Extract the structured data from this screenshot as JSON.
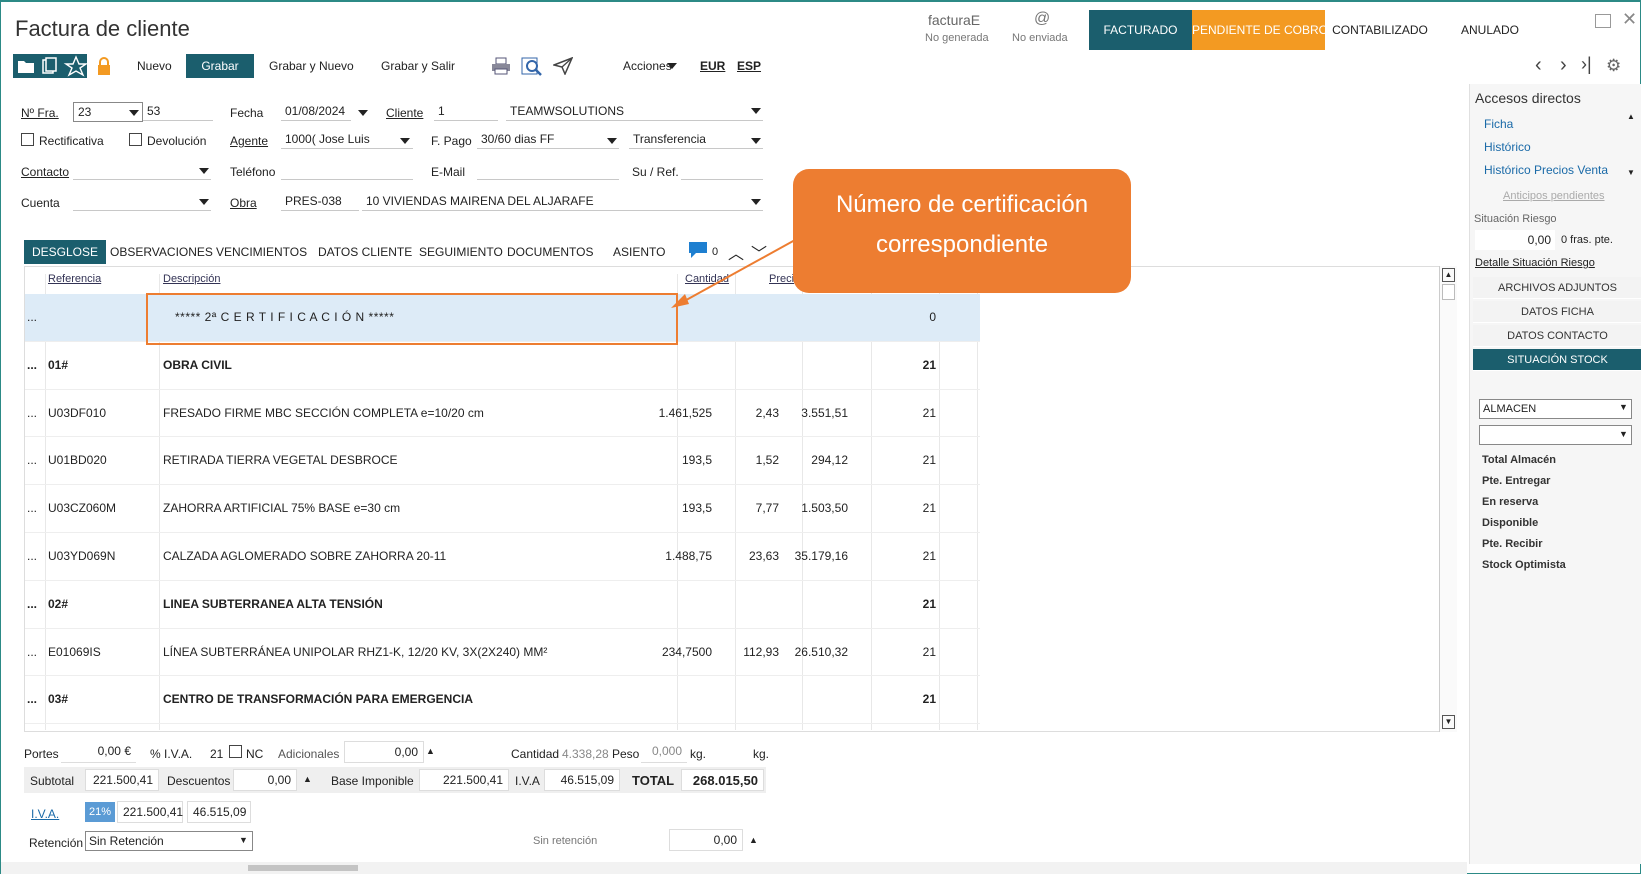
{
  "window": {
    "title": "Factura de cliente"
  },
  "status": {
    "factura_e": "facturaE",
    "no_generada": "No generada",
    "at": "@",
    "no_enviada": "No enviada",
    "facturado": "FACTURADO",
    "pendiente": "PENDIENTE DE COBRO",
    "contabilizado": "CONTABILIZADO",
    "anulado": "ANULADO"
  },
  "toolbar": {
    "nuevo": "Nuevo",
    "grabar": "Grabar",
    "grabar_nuevo": "Grabar y Nuevo",
    "grabar_salir": "Grabar y Salir",
    "acciones": "Acciones",
    "eur": "EUR",
    "esp": "ESP"
  },
  "form": {
    "nfra_label": "Nº Fra.",
    "nfra_serie": "23",
    "nfra_num": "53",
    "fecha_label": "Fecha",
    "fecha": "01/08/2024",
    "cliente_label": "Cliente",
    "cliente_code": "1",
    "cliente_name": "TEAMWSOLUTIONS",
    "rectificativa": "Rectificativa",
    "devolucion": "Devolución",
    "agente_label": "Agente",
    "agente_code": "1000(",
    "agente_name": "Jose Luis",
    "fpago_label": "F. Pago",
    "fpago": "30/60 dias FF",
    "transferencia": "Transferencia",
    "contacto_label": "Contacto",
    "telefono_label": "Teléfono",
    "email_label": "E-Mail",
    "suref_label": "Su / Ref.",
    "cuenta_label": "Cuenta",
    "obra_label": "Obra",
    "obra_code": "PRES-038",
    "obra_name": "10 VIVIENDAS MAIRENA DEL ALJARAFE"
  },
  "tabs": [
    "DESGLOSE",
    "OBSERVACIONES",
    "VENCIMIENTOS",
    "DATOS CLIENTE",
    "SEGUIMIENTO",
    "DOCUMENTOS",
    "ASIENTO"
  ],
  "comment_count": "0",
  "grid": {
    "headers": {
      "referencia": "Referencia",
      "descripcion": "Descripción",
      "cantidad": "Cantidad",
      "precio": "Preci"
    },
    "rows": [
      {
        "dots": "...",
        "ref": "",
        "desc": "***** 2ª   C E R T I F I C A C I Ó N *****",
        "cant": "",
        "precio": "",
        "importe": "",
        "iva": "0",
        "bold": false,
        "selected": true
      },
      {
        "dots": "...",
        "ref": "01#",
        "desc": "OBRA CIVIL",
        "cant": "",
        "precio": "",
        "importe": "",
        "iva": "21",
        "bold": true,
        "selected": false
      },
      {
        "dots": "...",
        "ref": "U03DF010",
        "desc": "FRESADO FIRME MBC SECCIÓN COMPLETA e=10/20 cm",
        "cant": "1.461,525",
        "precio": "2,43",
        "importe": "3.551,51",
        "iva": "21",
        "bold": false,
        "selected": false
      },
      {
        "dots": "...",
        "ref": "U01BD020",
        "desc": "RETIRADA TIERRA VEGETAL DESBROCE",
        "cant": "193,5",
        "precio": "1,52",
        "importe": "294,12",
        "iva": "21",
        "bold": false,
        "selected": false
      },
      {
        "dots": "...",
        "ref": "U03CZ060M",
        "desc": "ZAHORRA ARTIFICIAL 75% BASE e=30 cm",
        "cant": "193,5",
        "precio": "7,77",
        "importe": "1.503,50",
        "iva": "21",
        "bold": false,
        "selected": false
      },
      {
        "dots": "...",
        "ref": "U03YD069N",
        "desc": "CALZADA AGLOMERADO SOBRE ZAHORRA 20-11",
        "cant": "1.488,75",
        "precio": "23,63",
        "importe": "35.179,16",
        "iva": "21",
        "bold": false,
        "selected": false
      },
      {
        "dots": "...",
        "ref": "02#",
        "desc": "LINEA SUBTERRANEA ALTA TENSIÓN",
        "cant": "",
        "precio": "",
        "importe": "",
        "iva": "21",
        "bold": true,
        "selected": false
      },
      {
        "dots": "...",
        "ref": "E01069IS",
        "desc": "LÍNEA SUBTERRÁNEA UNIPOLAR RHZ1-K, 12/20 KV, 3X(2X240) MM²",
        "cant": "234,7500",
        "precio": "112,93",
        "importe": "26.510,32",
        "iva": "21",
        "bold": false,
        "selected": false
      },
      {
        "dots": "...",
        "ref": "03#",
        "desc": "CENTRO DE TRANSFORMACIÓN PARA EMERGENCIA",
        "cant": "",
        "precio": "",
        "importe": "",
        "iva": "21",
        "bold": true,
        "selected": false
      }
    ]
  },
  "callout": {
    "text": "Número de certificación correspondiente"
  },
  "sidebar": {
    "title": "Accesos directos",
    "links": [
      "Ficha",
      "Histórico",
      "Histórico Precios Venta"
    ],
    "anticipos": "Anticipos pendientes",
    "situacion": "Situación Riesgo",
    "riesgo_value": "0,00",
    "fras": "0 fras. pte.",
    "detalle": "Detalle Situación Riesgo",
    "buttons": [
      "ARCHIVOS ADJUNTOS",
      "DATOS FICHA",
      "DATOS CONTACTO",
      "SITUACIÓN STOCK"
    ],
    "almacen": "ALMACEN",
    "stock": [
      "Total Almacén",
      "Pte. Entregar",
      "En reserva",
      "Disponible",
      "Pte. Recibir",
      "Stock Optimista"
    ]
  },
  "totals": {
    "portes_label": "Portes",
    "portes": "0,00 €",
    "iva_pct_label": "% I.V.A.",
    "iva_pct": "21",
    "nc": "NC",
    "adicionales_label": "Adicionales",
    "adicionales": "0,00",
    "cantidad_label": "Cantidad",
    "cantidad": "4.338,28",
    "peso_label": "Peso",
    "peso": "0,000",
    "kg1": "kg.",
    "kg2": "kg.",
    "subtotal_label": "Subtotal",
    "subtotal": "221.500,41",
    "descuentos_label": "Descuentos",
    "descuentos": "0,00",
    "base_label": "Base Imponible",
    "base": "221.500,41",
    "iva_label": "I.V.A",
    "iva": "46.515,09",
    "total_label": "TOTAL",
    "total": "268.015,50",
    "iva_link": "I.V.A.",
    "iva_rate": "21%",
    "iva_base": "221.500,41",
    "iva_amount": "46.515,09",
    "retencion_label": "Retención",
    "retencion": "Sin Retención",
    "sin_ret_label": "Sin retención",
    "sin_ret": "0,00"
  }
}
